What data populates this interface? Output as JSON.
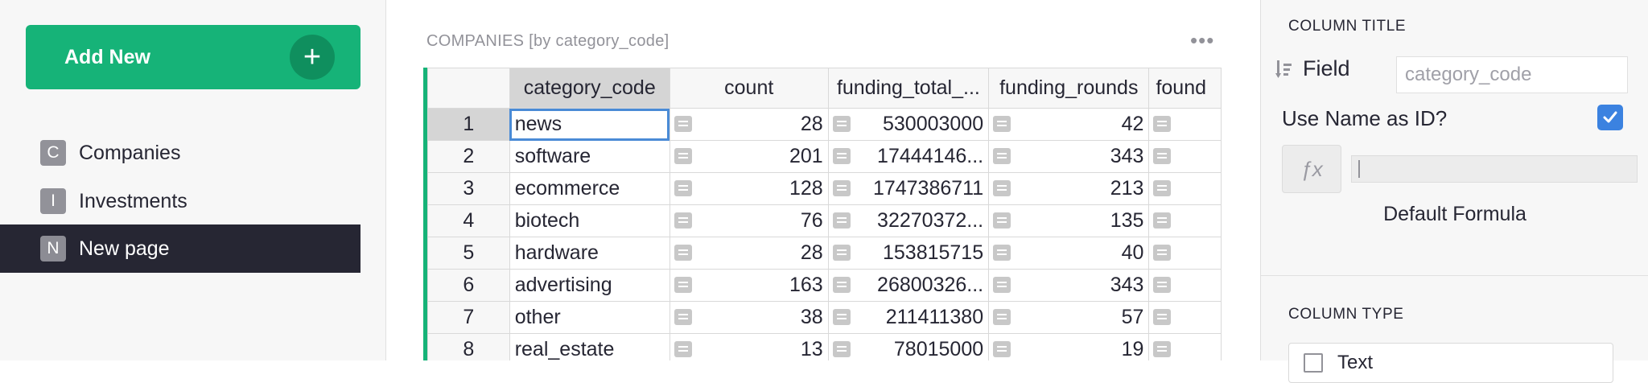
{
  "left": {
    "add_new_label": "Add New",
    "add_icon": "+",
    "pages": [
      {
        "letter": "C",
        "label": "Companies",
        "active": false
      },
      {
        "letter": "I",
        "label": "Investments",
        "active": false
      },
      {
        "letter": "N",
        "label": "New page",
        "active": true
      }
    ]
  },
  "section": {
    "title": "COMPANIES [by category_code]",
    "menu": "•••"
  },
  "grid": {
    "columns": [
      "category_code",
      "count",
      "funding_total_...",
      "funding_rounds",
      "found"
    ],
    "rows": [
      {
        "n": "1",
        "category_code": "news",
        "count": "28",
        "funding_total": "530003000",
        "funding_rounds": "42"
      },
      {
        "n": "2",
        "category_code": "software",
        "count": "201",
        "funding_total": "17444146...",
        "funding_rounds": "343"
      },
      {
        "n": "3",
        "category_code": "ecommerce",
        "count": "128",
        "funding_total": "1747386711",
        "funding_rounds": "213"
      },
      {
        "n": "4",
        "category_code": "biotech",
        "count": "76",
        "funding_total": "32270372...",
        "funding_rounds": "135"
      },
      {
        "n": "5",
        "category_code": "hardware",
        "count": "28",
        "funding_total": "153815715",
        "funding_rounds": "40"
      },
      {
        "n": "6",
        "category_code": "advertising",
        "count": "163",
        "funding_total": "26800326...",
        "funding_rounds": "343"
      },
      {
        "n": "7",
        "category_code": "other",
        "count": "38",
        "funding_total": "211411380",
        "funding_rounds": "57"
      },
      {
        "n": "8",
        "category_code": "real_estate",
        "count": "13",
        "funding_total": "78015000",
        "funding_rounds": "19"
      }
    ]
  },
  "right": {
    "column_title_caption": "COLUMN TITLE",
    "field_label": "Field",
    "field_value": "category_code",
    "use_name_label": "Use Name as ID?",
    "fx_label": "ƒx",
    "default_formula_label": "Default Formula",
    "column_type_caption": "COLUMN TYPE",
    "column_type_value": "Text"
  },
  "colors": {
    "accent_green": "#16b378",
    "active_page_bg": "#262633",
    "checkbox_blue": "#3b82e0",
    "cursor_blue": "#4a8bd6"
  }
}
